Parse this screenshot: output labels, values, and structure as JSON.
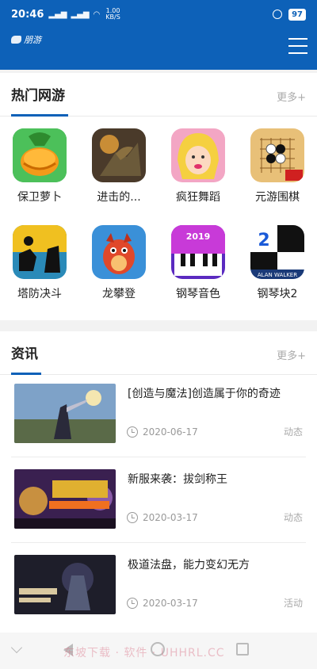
{
  "status_bar": {
    "time": "20:46",
    "signal_1": "ₕd",
    "signal_2": "ₕd",
    "net_speed": "1.00",
    "net_unit": "KB/S",
    "battery": "97"
  },
  "header": {
    "logo_text": "朋游"
  },
  "hot_games": {
    "title": "热门网游",
    "more": "更多+",
    "items": [
      {
        "name": "保卫萝卜",
        "icon": "carrot-game-icon"
      },
      {
        "name": "进击的...",
        "icon": "dragon-game-icon"
      },
      {
        "name": "疯狂舞蹈",
        "icon": "dancer-game-icon"
      },
      {
        "name": "元游围棋",
        "icon": "go-board-game-icon"
      },
      {
        "name": "塔防决斗",
        "icon": "tower-defense-game-icon"
      },
      {
        "name": "龙攀登",
        "icon": "dragon-climb-game-icon"
      },
      {
        "name": "钢琴音色",
        "icon": "piano-2019-game-icon"
      },
      {
        "name": "钢琴块2",
        "icon": "piano-tiles-2-game-icon"
      }
    ],
    "icon_labels": {
      "piano_year": "2019",
      "tiles_brand": "ALAN WALKER",
      "tiles_number": "2"
    }
  },
  "news": {
    "title": "资讯",
    "more": "更多+",
    "items": [
      {
        "title": "[创造与魔法]创造属于你的奇迹",
        "date": "2020-06-17",
        "tag": "动态",
        "thumb": "fantasy-hero-thumbnail"
      },
      {
        "title": "新服来袭：拔剑称王",
        "date": "2020-03-17",
        "tag": "动态",
        "thumb": "battle-banner-thumbnail"
      },
      {
        "title": "极道法盘，能力变幻无方",
        "date": "2020-03-17",
        "tag": "活动",
        "thumb": "dark-knight-thumbnail"
      }
    ]
  },
  "watermark": "东坡下载 · 软件 · UHHRL.CC",
  "colors": {
    "brand_blue": "#0d61b8",
    "text": "#222222",
    "muted": "#999999"
  }
}
